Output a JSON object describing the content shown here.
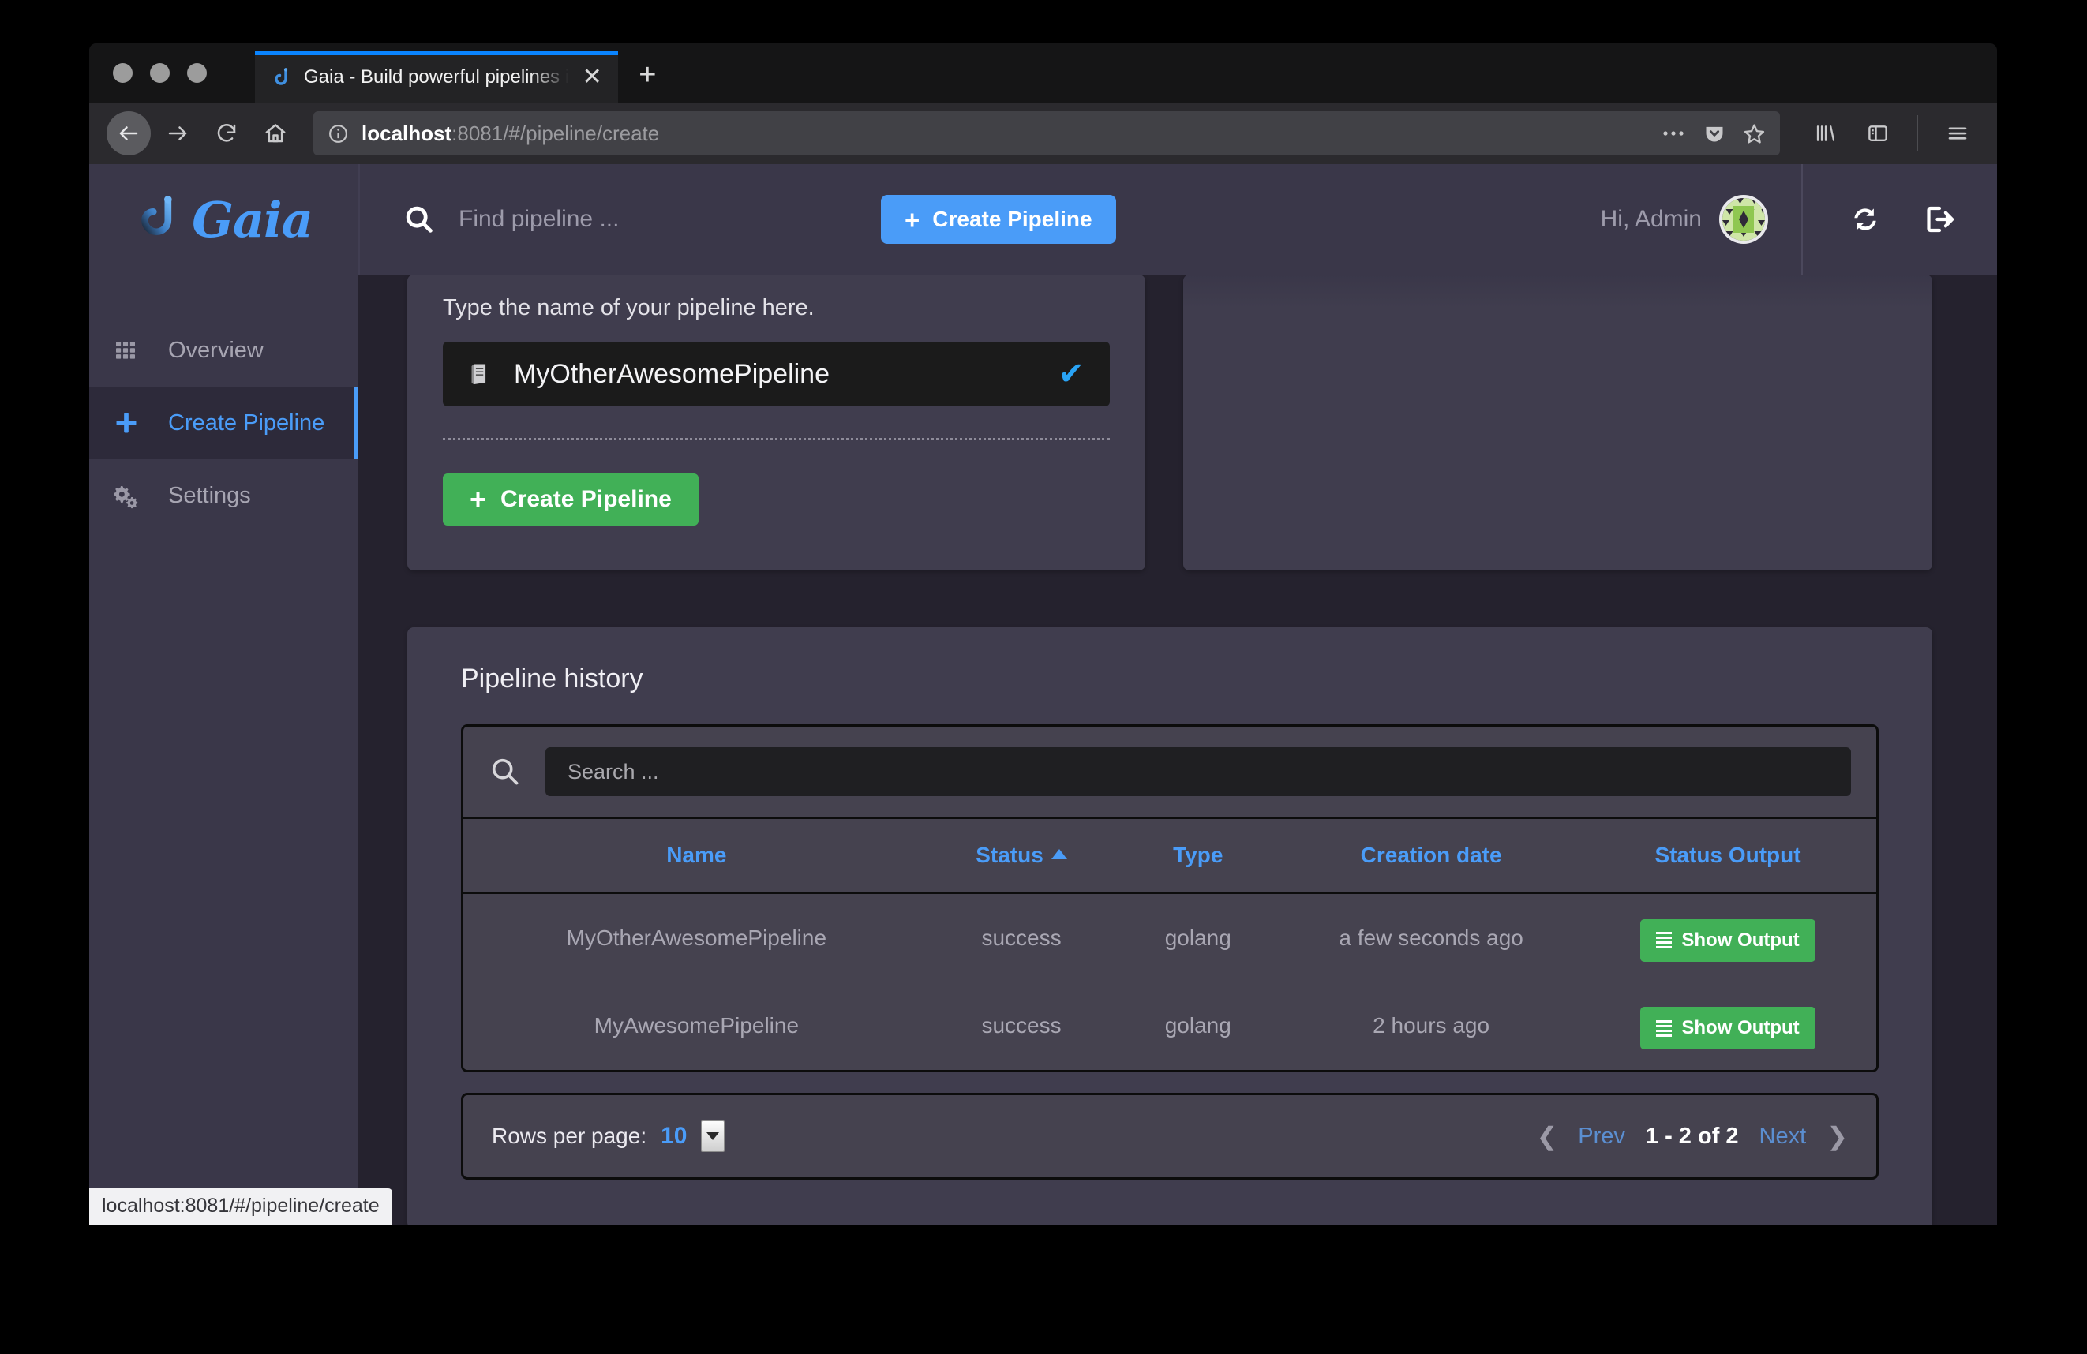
{
  "browser": {
    "tab": {
      "title": "Gaia - Build powerful pipelines i",
      "favicon_icon": "gaia-hook-icon",
      "close_icon": "close-icon"
    },
    "new_tab_label": "+",
    "nav": {
      "back_icon": "back-arrow-icon",
      "forward_icon": "forward-arrow-icon",
      "reload_icon": "reload-icon",
      "home_icon": "home-icon",
      "info_icon": "info-icon",
      "url_host": "localhost",
      "url_path": ":8081/#/pipeline/create",
      "url_full": "localhost:8081/#/pipeline/create",
      "page_actions_icon": "ellipsis-icon",
      "pocket_icon": "pocket-icon",
      "bookmark_icon": "star-icon",
      "library_icon": "library-icon",
      "sidebar_icon": "sidebar-icon",
      "menu_icon": "hamburger-menu-icon"
    },
    "status_link": "localhost:8081/#/pipeline/create"
  },
  "app": {
    "brand": {
      "name": "Gaia",
      "logo_icon": "gaia-hook-icon"
    },
    "sidebar": {
      "items": [
        {
          "label": "Overview",
          "icon": "grid-icon",
          "active": false
        },
        {
          "label": "Create Pipeline",
          "icon": "plus-icon",
          "active": true
        },
        {
          "label": "Settings",
          "icon": "gears-icon",
          "active": false
        }
      ]
    },
    "topbar": {
      "search_icon": "search-icon",
      "search_placeholder": "Find pipeline ...",
      "create_button": {
        "label": "Create Pipeline",
        "icon": "plus-icon"
      },
      "greeting": "Hi, Admin",
      "avatar_icon": "user-avatar-identicon",
      "refresh_icon": "refresh-icon",
      "logout_icon": "logout-icon"
    },
    "create_form": {
      "label": "Type the name of your pipeline here.",
      "name_icon": "book-icon",
      "name_value": "MyOtherAwesomePipeline",
      "valid_icon": "check-icon",
      "submit_button": {
        "label": "Create Pipeline",
        "icon": "plus-icon"
      }
    },
    "history": {
      "title": "Pipeline history",
      "search_icon": "search-icon",
      "search_placeholder": "Search ...",
      "columns": [
        {
          "label": "Name",
          "sorted": false
        },
        {
          "label": "Status",
          "sorted": true,
          "direction": "asc"
        },
        {
          "label": "Type",
          "sorted": false
        },
        {
          "label": "Creation date",
          "sorted": false
        },
        {
          "label": "Status Output",
          "sorted": false
        }
      ],
      "rows": [
        {
          "name": "MyOtherAwesomePipeline",
          "status": "success",
          "type": "golang",
          "creation_date": "a few seconds ago",
          "output_button": {
            "label": "Show Output",
            "icon": "list-icon"
          }
        },
        {
          "name": "MyAwesomePipeline",
          "status": "success",
          "type": "golang",
          "creation_date": "2 hours ago",
          "output_button": {
            "label": "Show Output",
            "icon": "list-icon"
          }
        }
      ],
      "pagination": {
        "rows_per_page_label": "Rows per page:",
        "rows_per_page_value": "10",
        "prev_label": "Prev",
        "range_label": "1 - 2 of 2",
        "next_label": "Next",
        "prev_icon": "chevron-left-icon",
        "next_icon": "chevron-right-icon"
      }
    }
  },
  "colors": {
    "accent_blue": "#4a9cf8",
    "success_green": "#41b057",
    "status_green": "#2fb14c",
    "sidebar_bg": "#3a3749",
    "page_bg": "#25222e",
    "card_bg": "#403d4e"
  }
}
